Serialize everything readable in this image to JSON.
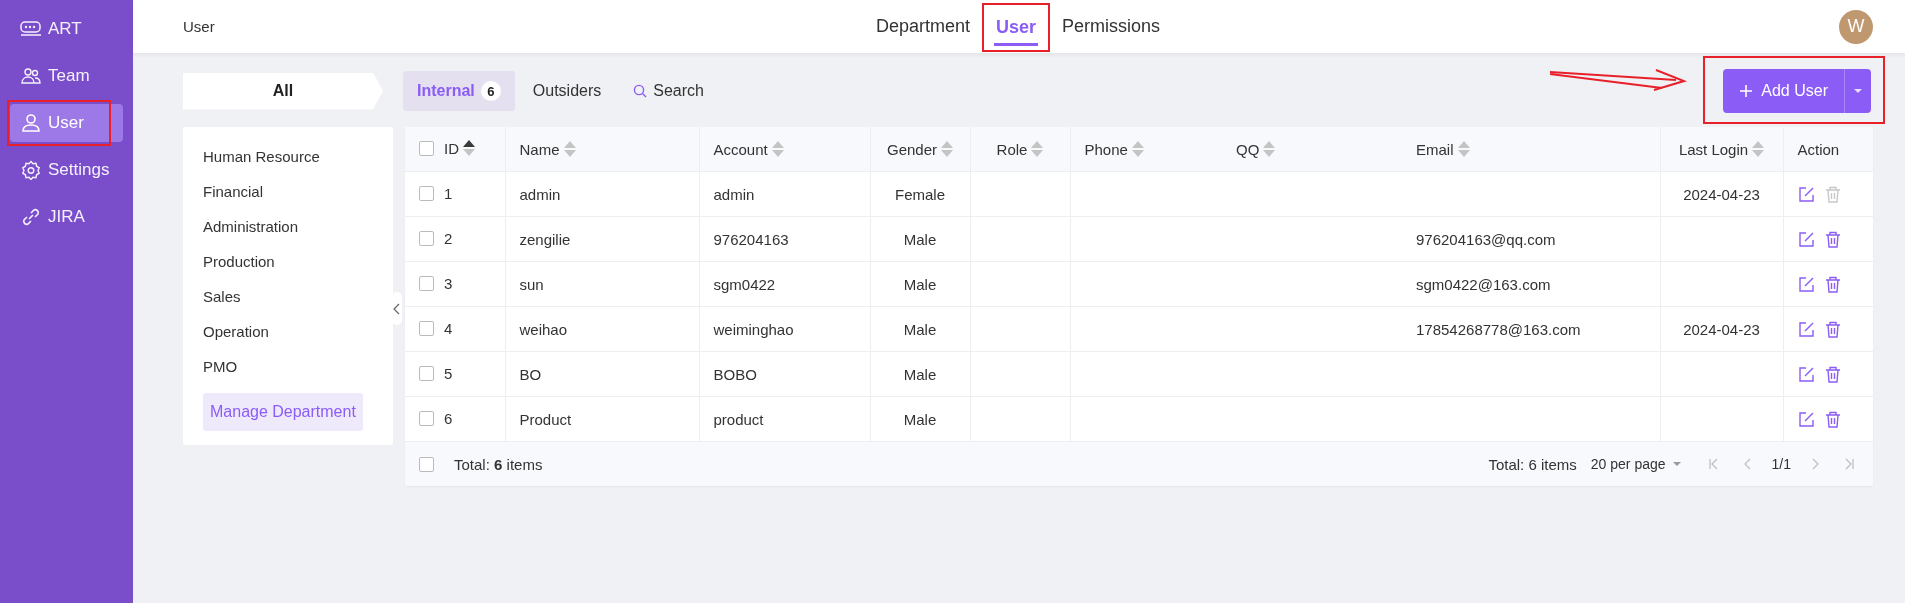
{
  "sidebar": {
    "items": [
      {
        "label": "ART",
        "kind": "brand",
        "selected": false,
        "highlighted": false
      },
      {
        "label": "Team",
        "kind": "team",
        "selected": false,
        "highlighted": false
      },
      {
        "label": "User",
        "kind": "user",
        "selected": true,
        "highlighted": true
      },
      {
        "label": "Settings",
        "kind": "settings",
        "selected": false,
        "highlighted": false
      },
      {
        "label": "JIRA",
        "kind": "link",
        "selected": false,
        "highlighted": false
      }
    ]
  },
  "header": {
    "page_title": "User",
    "tabs": [
      {
        "label": "Department",
        "selected": false,
        "highlighted": false
      },
      {
        "label": "User",
        "selected": true,
        "highlighted": true
      },
      {
        "label": "Permissions",
        "selected": false,
        "highlighted": false
      }
    ],
    "avatar": "W"
  },
  "scope": {
    "label": "All"
  },
  "subtabs": [
    {
      "label": "Internal",
      "kind": "tab",
      "selected": true,
      "count": "6"
    },
    {
      "label": "Outsiders",
      "kind": "tab",
      "selected": false
    },
    {
      "label": "Search",
      "kind": "search"
    }
  ],
  "add_button": {
    "label": "Add User",
    "highlighted": true
  },
  "departments": {
    "items": [
      "Human Resource",
      "Financial",
      "Administration",
      "Production",
      "Sales",
      "Operation",
      "PMO"
    ],
    "manage_button": "Manage Department"
  },
  "table": {
    "select_all_checked": false,
    "columns": [
      {
        "label": "ID",
        "kind": "sortable",
        "sorted_ascending": true
      },
      {
        "label": "Name",
        "kind": "sortable",
        "sorted_ascending": false
      },
      {
        "label": "Account",
        "kind": "sortable",
        "sorted_ascending": false
      },
      {
        "label": "Gender",
        "kind": "sortable",
        "sorted_ascending": false
      },
      {
        "label": "Role",
        "kind": "sortable",
        "sorted_ascending": false
      },
      {
        "label": "Phone",
        "kind": "sortable",
        "sorted_ascending": false
      },
      {
        "label": "QQ",
        "kind": "sortable",
        "sorted_ascending": false
      },
      {
        "label": "Email",
        "kind": "sortable",
        "sorted_ascending": false
      },
      {
        "label": "Last Login",
        "kind": "sortable",
        "sorted_ascending": false
      },
      {
        "label": "Action",
        "kind": "plain"
      }
    ],
    "rows": [
      {
        "checked": false,
        "cells": [
          "1",
          "admin",
          "admin",
          "Female",
          "",
          "",
          "",
          "",
          "2024-04-23"
        ],
        "delete_disabled": true
      },
      {
        "checked": false,
        "cells": [
          "2",
          "zengilie",
          "976204163",
          "Male",
          "",
          "",
          "",
          "976204163@qq.com",
          ""
        ],
        "delete_disabled": false
      },
      {
        "checked": false,
        "cells": [
          "3",
          "sun",
          "sgm0422",
          "Male",
          "",
          "",
          "",
          "sgm0422@163.com",
          ""
        ],
        "delete_disabled": false
      },
      {
        "checked": false,
        "cells": [
          "4",
          "weihao",
          "weiminghao",
          "Male",
          "",
          "",
          "",
          "17854268778@163.com",
          "2024-04-23"
        ],
        "delete_disabled": false
      },
      {
        "checked": false,
        "cells": [
          "5",
          "BO",
          "BOBO",
          "Male",
          "",
          "",
          "",
          "",
          ""
        ],
        "delete_disabled": false
      },
      {
        "checked": false,
        "cells": [
          "6",
          "Product",
          "product",
          "Male",
          "",
          "",
          "",
          "",
          ""
        ],
        "delete_disabled": false
      }
    ],
    "footer": {
      "checked": false,
      "total": "Total: **6** items"
    }
  },
  "pagination": {
    "total": "Total: 6 items",
    "page_size": "20 per page",
    "page": "1/1",
    "prev_disabled": true,
    "next_disabled": true
  }
}
